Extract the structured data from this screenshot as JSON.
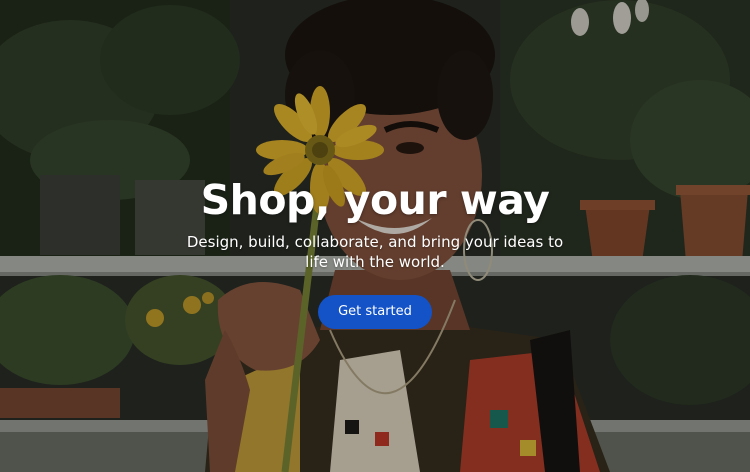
{
  "hero": {
    "title": "Shop, your way",
    "subtitle": "Design, build, collaborate, and bring your ideas to life with the world.",
    "cta_label": "Get started"
  },
  "colors": {
    "cta_background": "#1453c7",
    "text": "#ffffff",
    "flower": "#e8b82a"
  },
  "background_photo": "woman holding a yellow gerbera flower in front of potted plants on a shelf"
}
